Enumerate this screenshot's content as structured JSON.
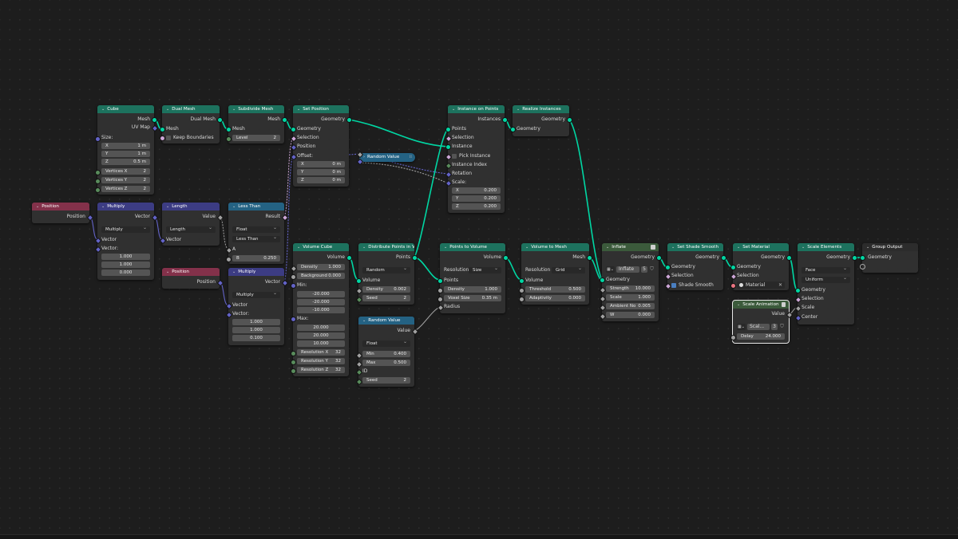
{
  "editor": "Geometry Node Editor",
  "nodes": {
    "cube": {
      "title": "Cube",
      "out_mesh": "Mesh",
      "out_uv": "UV Map",
      "size_label": "Size:",
      "x_label": "X",
      "x_value": "1 m",
      "y_label": "Y",
      "y_value": "1 m",
      "z_label": "Z",
      "z_value": "0.5 m",
      "vx_label": "Vertices X",
      "vx_value": "2",
      "vy_label": "Vertices Y",
      "vy_value": "2",
      "vz_label": "Vertices Z",
      "vz_value": "2"
    },
    "dual_mesh": {
      "title": "Dual Mesh",
      "out": "Dual Mesh",
      "in_mesh": "Mesh",
      "keep": "Keep Boundaries"
    },
    "subdivide": {
      "title": "Subdivide Mesh",
      "out": "Mesh",
      "in_mesh": "Mesh",
      "level_label": "Level",
      "level_value": "2"
    },
    "set_position": {
      "title": "Set Position",
      "out": "Geometry",
      "in_geo": "Geometry",
      "selection": "Selection",
      "position": "Position",
      "offset": "Offset:",
      "x_label": "X",
      "x_value": "0 m",
      "y_label": "Y",
      "y_value": "0 m",
      "z_label": "Z",
      "z_value": "0 m"
    },
    "random_value_collapsed": {
      "title": "Random Value"
    },
    "instance_on_points": {
      "title": "Instance on Points",
      "out": "Instances",
      "points": "Points",
      "selection": "Selection",
      "instance": "Instance",
      "pick": "Pick Instance",
      "index": "Instance Index",
      "rotation": "Rotation",
      "scale": "Scale:",
      "x_label": "X",
      "x_value": "0.200",
      "y_label": "Y",
      "y_value": "0.200",
      "z_label": "Z",
      "z_value": "0.200"
    },
    "realize": {
      "title": "Realize Instances",
      "out": "Geometry",
      "in_geo": "Geometry"
    },
    "position1": {
      "title": "Position",
      "out": "Position"
    },
    "multiply1": {
      "title": "Multiply",
      "out": "Vector",
      "mode": "Multiply",
      "in1": "Vector",
      "in2": "Vector:",
      "v1": "1.000",
      "v2": "1.000",
      "v3": "0.000"
    },
    "length": {
      "title": "Length",
      "out": "Value",
      "mode": "Length",
      "in": "Vector"
    },
    "less_than": {
      "title": "Less Than",
      "out": "Result",
      "type": "Float",
      "mode": "Less Than",
      "a": "A",
      "b_label": "B",
      "b_value": "0.250"
    },
    "position2": {
      "title": "Position",
      "out": "Position"
    },
    "multiply2": {
      "title": "Multiply",
      "out": "Vector",
      "mode": "Multiply",
      "in1": "Vector",
      "in2": "Vector:",
      "v1": "1.000",
      "v2": "1.000",
      "v3": "0.100"
    },
    "volume_cube": {
      "title": "Volume Cube",
      "out": "Volume",
      "density_label": "Density",
      "density_value": "1.000",
      "bg_label": "Background",
      "bg_value": "0.000",
      "min": "Min:",
      "min1": "-20.000",
      "min2": "-20.000",
      "min3": "-10.000",
      "max": "Max:",
      "max1": "20.000",
      "max2": "20.000",
      "max3": "10.000",
      "rx_label": "Resolution X",
      "rx_value": "32",
      "ry_label": "Resolution Y",
      "ry_value": "32",
      "rz_label": "Resolution Z",
      "rz_value": "32"
    },
    "distribute": {
      "title": "Distribute Points in Volume",
      "out": "Points",
      "mode": "Random",
      "in_volume": "Volume",
      "density_label": "Density",
      "density_value": "0.002",
      "seed_label": "Seed",
      "seed_value": "2"
    },
    "random_value2": {
      "title": "Random Value",
      "out": "Value",
      "type": "Float",
      "min_label": "Min",
      "min_value": "0.400",
      "max_label": "Max",
      "max_value": "0.500",
      "id": "ID",
      "seed_label": "Seed",
      "seed_value": "2"
    },
    "points_to_volume": {
      "title": "Points to Volume",
      "out": "Volume",
      "res_label": "Resolution",
      "res_mode": "Size",
      "points": "Points",
      "density_label": "Density",
      "density_value": "1.000",
      "voxel_label": "Voxel Size",
      "voxel_value": "0.35 m",
      "radius": "Radius"
    },
    "volume_to_mesh": {
      "title": "Volume to Mesh",
      "out": "Mesh",
      "res_label": "Resolution",
      "res_mode": "Grid",
      "in_volume": "Volume",
      "threshold_label": "Threshold",
      "threshold_value": "0.500",
      "adapt_label": "Adaptivity",
      "adapt_value": "0.000"
    },
    "inflate": {
      "title": "Inflate",
      "out": "Geometry",
      "group_name": "Inflate",
      "users": "5",
      "in_geo": "Geometry",
      "strength_label": "Strength",
      "strength_value": "10.000",
      "scale_label": "Scale",
      "scale_value": "1.000",
      "ambient_label": "Ambient No",
      "ambient_value": "0.005",
      "w_label": "W",
      "w_value": "0.000"
    },
    "shade_smooth": {
      "title": "Set Shade Smooth",
      "out": "Geometry",
      "in_geo": "Geometry",
      "selection": "Selection",
      "smooth": "Shade Smooth"
    },
    "set_material": {
      "title": "Set Material",
      "out": "Geometry",
      "in_geo": "Geometry",
      "selection": "Selection",
      "material": "Material"
    },
    "scale_elements": {
      "title": "Scale Elements",
      "out": "Geometry",
      "domain": "Face",
      "mode": "Uniform",
      "in_geo": "Geometry",
      "selection": "Selection",
      "scale": "Scale",
      "center": "Center"
    },
    "group_output": {
      "title": "Group Output",
      "in_geo": "Geometry"
    },
    "scale_animation": {
      "title": "Scale Animation",
      "out": "Value",
      "group_name": "Scal...",
      "users": "3",
      "delay_label": "Delay",
      "delay_value": "24.000"
    }
  },
  "colors": {
    "geometry_link": "#00d6a3",
    "vector_link": "#6363c7",
    "float_link": "#a1a1a1",
    "geometry_header": "#1d725e",
    "input_header": "#83314a",
    "vector_header": "#3c3c83",
    "function_header": "#246283"
  }
}
